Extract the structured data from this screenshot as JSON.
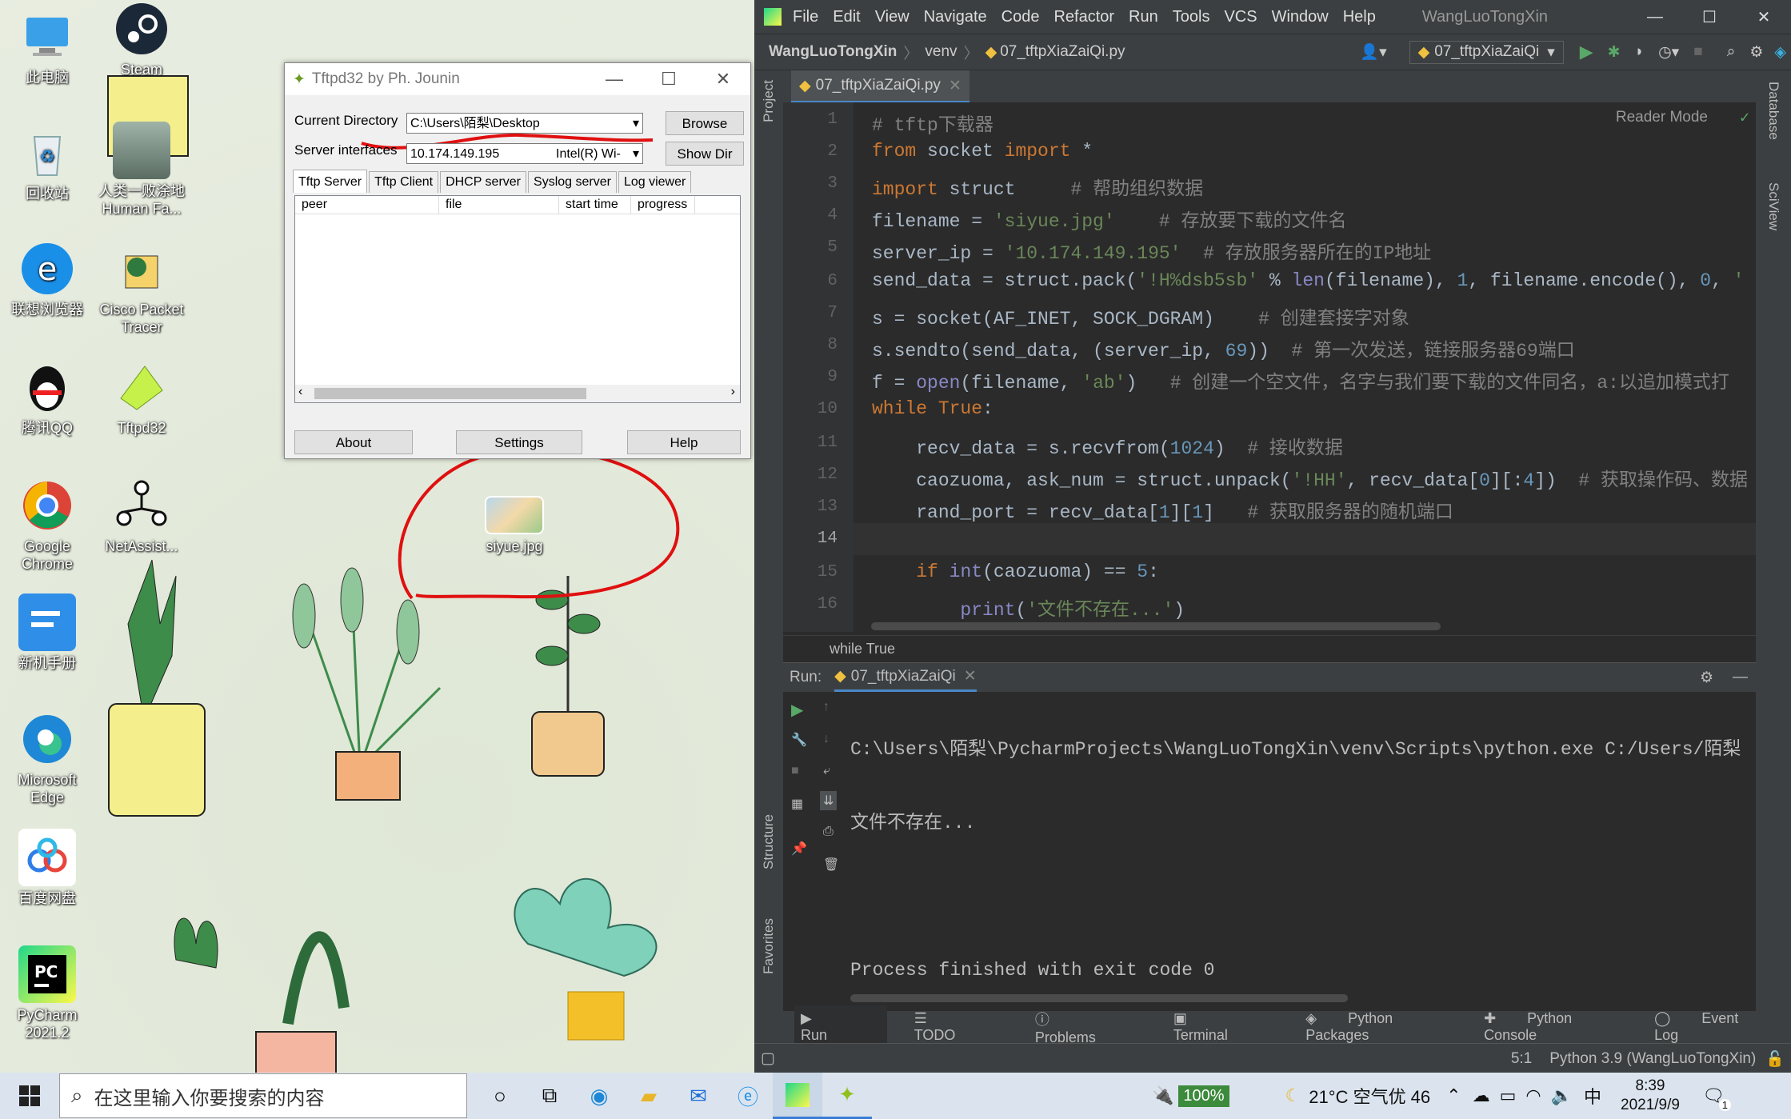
{
  "desktop": {
    "icons": [
      {
        "label": "此电脑"
      },
      {
        "label": "Steam"
      },
      {
        "label": "回收站"
      },
      {
        "label": "人类一败涂地 Human Fa..."
      },
      {
        "label": "联想浏览器"
      },
      {
        "label": "Cisco Packet Tracer"
      },
      {
        "label": "腾讯QQ"
      },
      {
        "label": "Tftpd32"
      },
      {
        "label": "Google Chrome"
      },
      {
        "label": "NetAssist..."
      },
      {
        "label": "新机手册"
      },
      {
        "label": "Microsoft Edge"
      },
      {
        "label": "百度网盘"
      },
      {
        "label": "PyCharm 2021.2"
      }
    ],
    "file_icon_label": "siyue.jpg"
  },
  "tftpd": {
    "title": "Tftpd32 by Ph. Jounin",
    "current_directory_label": "Current Directory",
    "current_directory_value": "C:\\Users\\陌梨\\Desktop",
    "server_interfaces_label": "Server interfaces",
    "server_interfaces_value": "10.174.149.195",
    "server_interfaces_adapter": "Intel(R) Wi-",
    "browse_label": "Browse",
    "showdir_label": "Show Dir",
    "tabs": [
      "Tftp Server",
      "Tftp Client",
      "DHCP server",
      "Syslog server",
      "Log viewer"
    ],
    "columns": [
      "peer",
      "file",
      "start time",
      "progress"
    ],
    "about_label": "About",
    "settings_label": "Settings",
    "help_label": "Help"
  },
  "pycharm": {
    "menu": [
      "File",
      "Edit",
      "View",
      "Navigate",
      "Code",
      "Refactor",
      "Run",
      "Tools",
      "VCS",
      "Window",
      "Help"
    ],
    "project_title": "WangLuoTongXin",
    "breadcrumb": [
      "WangLuoTongXin",
      "venv",
      "07_tftpXiaZaiQi.py"
    ],
    "run_config": "07_tftpXiaZaiQi",
    "file_tab": "07_tftpXiaZaiQi.py",
    "reader_mode": "Reader Mode",
    "breadcrumb_footer": "while True",
    "left_tools": [
      "Project",
      "Structure",
      "Favorites"
    ],
    "right_tools": [
      "Database",
      "SciView"
    ],
    "line_numbers": [
      "1",
      "2",
      "3",
      "4",
      "5",
      "6",
      "7",
      "8",
      "9",
      "10",
      "11",
      "12",
      "13",
      "14",
      "15",
      "16"
    ],
    "run_label": "Run:",
    "run_tab": "07_tftpXiaZaiQi",
    "console_lines": [
      "C:\\Users\\陌梨\\PycharmProjects\\WangLuoTongXin\\venv\\Scripts\\python.exe C:/Users/陌梨",
      "文件不存在...",
      "",
      "Process finished with exit code 0"
    ],
    "bottom_tabs": [
      "Run",
      "TODO",
      "Problems",
      "Terminal",
      "Python Packages",
      "Python Console"
    ],
    "event_log": "Event Log",
    "status_position": "5:1",
    "status_interpreter": "Python 3.9 (WangLuoTongXin)"
  },
  "taskbar": {
    "search_placeholder": "在这里输入你要搜索的内容",
    "battery": "100%",
    "weather": "21°C 空气优 46",
    "ime": "中",
    "time": "8:39",
    "date": "2021/9/9",
    "notifications": "1"
  },
  "colors": {
    "annotation_red": "#e01010",
    "pycharm_bg": "#2b2b2b",
    "pycharm_panel": "#3c3f41"
  }
}
